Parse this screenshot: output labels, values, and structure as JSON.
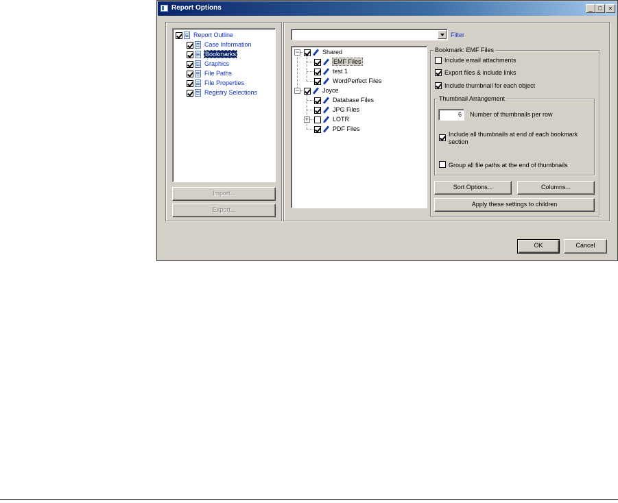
{
  "window": {
    "title": "Report Options"
  },
  "outline": {
    "root": "Report Outline",
    "items": [
      {
        "label": "Case Information",
        "checked": true
      },
      {
        "label": "Bookmarks",
        "checked": true
      },
      {
        "label": "Graphics",
        "checked": true
      },
      {
        "label": "File Paths",
        "checked": true
      },
      {
        "label": "File Properties",
        "checked": true
      },
      {
        "label": "Registry Selections",
        "checked": true
      }
    ],
    "import_label": "Import...",
    "export_label": "Export..."
  },
  "filter": {
    "value": "",
    "label": "Filter"
  },
  "tree": {
    "shared": {
      "label": "Shared",
      "expander": "−"
    },
    "shared_items": [
      {
        "label": "EMF Files",
        "checked": true
      },
      {
        "label": "test 1",
        "checked": true
      },
      {
        "label": "WordPerfect Files",
        "checked": true
      }
    ],
    "joyce": {
      "label": "Joyce",
      "expander": "−"
    },
    "joyce_items": [
      {
        "label": "Database Files",
        "checked": true
      },
      {
        "label": "JPG Files",
        "checked": true
      },
      {
        "label": "LOTR",
        "checked": false,
        "expander": "+"
      },
      {
        "label": "PDF Files",
        "checked": true
      }
    ]
  },
  "bookmark": {
    "group_title": "Bookmark: EMF Files",
    "include_email": "Include email attachments",
    "export_files": "Export files & include links",
    "include_thumbnail": "Include thumbnail for each object",
    "thumb_group_title": "Thumbnail Arrangement",
    "thumbs_per_row_value": "6",
    "thumbs_per_row_label": "Number of thumbnails per row",
    "include_all_thumbs_line1": "Include all thumbnails at end of each bookmark",
    "include_all_thumbs_line2": "section",
    "group_paths": "Group all file paths at the end of thumbnails",
    "sort_options": "Sort Options...",
    "columns": "Columns...",
    "apply_children": "Apply these settings to children"
  },
  "footer": {
    "ok": "OK",
    "cancel": "Cancel"
  },
  "titlebar_buttons": {
    "minimize": "_",
    "maximize": "□",
    "close": "×"
  }
}
